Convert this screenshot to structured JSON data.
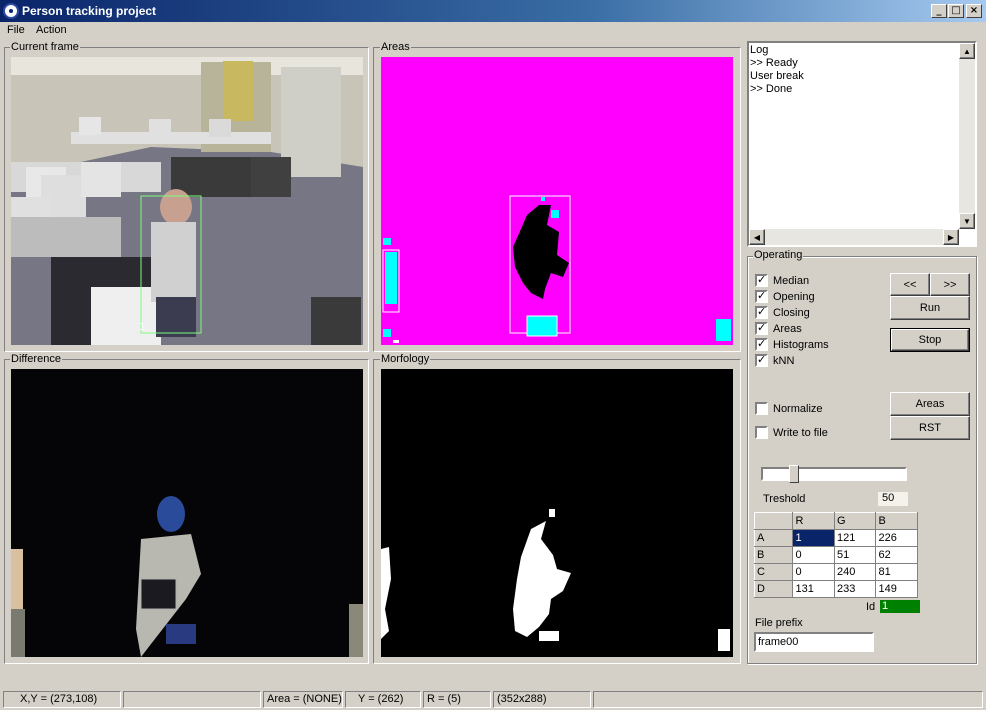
{
  "window": {
    "title": "Person tracking project"
  },
  "menu": [
    "File",
    "Action"
  ],
  "panels": {
    "current_frame": "Current frame",
    "areas": "Areas",
    "difference": "Difference",
    "morfology": "Morfology"
  },
  "current_frame": {
    "person_id_label": "1"
  },
  "log": {
    "lines": [
      "Log",
      ">> Ready",
      "User break",
      ">> Done"
    ]
  },
  "operating": {
    "title": "Operating",
    "checkboxes": [
      {
        "label": "Median",
        "checked": true
      },
      {
        "label": "Opening",
        "checked": true
      },
      {
        "label": "Closing",
        "checked": true
      },
      {
        "label": "Areas",
        "checked": true
      },
      {
        "label": "Histograms",
        "checked": true
      },
      {
        "label": "kNN",
        "checked": true
      },
      {
        "label": "Normalize",
        "checked": false
      },
      {
        "label": "Write to file",
        "checked": false
      }
    ],
    "buttons": {
      "prev": "<<",
      "next": ">>",
      "run": "Run",
      "stop": "Stop",
      "areas": "Areas",
      "rst": "RST"
    },
    "treshold_label": "Treshold",
    "treshold_value": "50",
    "slider_level": 0.2,
    "grid": {
      "columns": [
        "",
        "R",
        "G",
        "B"
      ],
      "rows": [
        [
          "A",
          "1",
          "121",
          "226"
        ],
        [
          "B",
          "0",
          "51",
          "62"
        ],
        [
          "C",
          "0",
          "240",
          "81"
        ],
        [
          "D",
          "131",
          "233",
          "149"
        ]
      ]
    },
    "id_label": "Id",
    "id_value": "1",
    "file_prefix_label": "File prefix",
    "file_prefix_value": "frame00"
  },
  "status": [
    "X,Y = (273,108)",
    "",
    "Area = (NONE)",
    "Y = (262)",
    "R = (5)",
    "(352x288)",
    ""
  ],
  "colors": {
    "areas_bg": "#ff00ff",
    "area_blob": "#00ffff",
    "id_badge": "#008000",
    "selection": "#0a246a"
  }
}
